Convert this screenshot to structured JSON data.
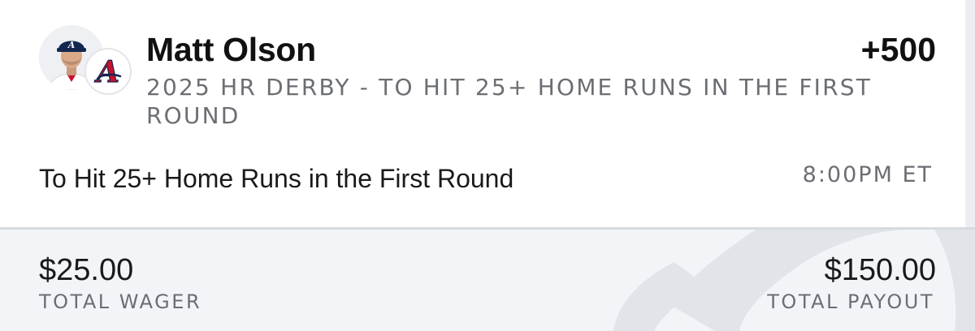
{
  "bet": {
    "player_name": "Matt Olson",
    "odds": "+500",
    "market": "2025 HR DERBY - TO HIT 25+ HOME RUNS IN THE FIRST ROUND",
    "selection": "To Hit 25+ Home Runs in the First Round",
    "event_time": "8:00PM ET",
    "team_logo_letter": "A"
  },
  "summary": {
    "wager_amount": "$25.00",
    "wager_label": "TOTAL WAGER",
    "payout_amount": "$150.00",
    "payout_label": "TOTAL PAYOUT"
  },
  "icons": {
    "player_avatar": "player-headshot",
    "team_logo": "braves-logo",
    "watermark": "sportsbook-watermark-icon"
  },
  "colors": {
    "primary_text": "#111111",
    "secondary_text": "#6b6e73",
    "footer_background": "#f2f5f8",
    "team_red": "#c8102e",
    "team_navy": "#13274f"
  }
}
